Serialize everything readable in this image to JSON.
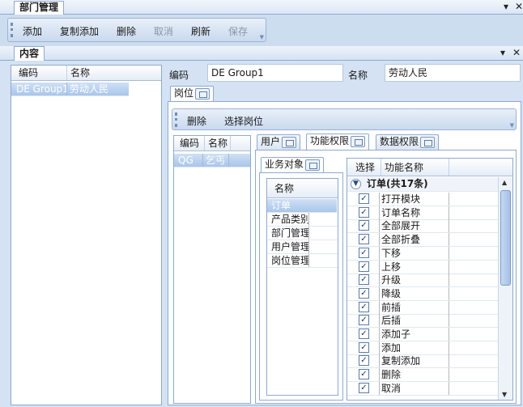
{
  "document": {
    "title": "部门管理",
    "controls": {
      "pin": "▾",
      "close": "✕"
    }
  },
  "toolbar": {
    "buttons": [
      {
        "label": "添加"
      },
      {
        "label": "复制添加"
      },
      {
        "label": "删除"
      },
      {
        "label": "取消"
      },
      {
        "label": "刷新"
      },
      {
        "label": "保存"
      }
    ]
  },
  "content_panel": {
    "title": "内容",
    "controls": {
      "pin": "▾",
      "close": "✕"
    }
  },
  "left_grid": {
    "headers": [
      "编码",
      "名称"
    ],
    "rows": [
      {
        "code": "DE Group1",
        "name": "劳动人民"
      }
    ]
  },
  "form": {
    "code_label": "编码",
    "code_value": "DE Group1",
    "name_label": "名称",
    "name_value": "劳动人民"
  },
  "position_tab": {
    "label": "岗位"
  },
  "position_toolbar": {
    "delete": "删除",
    "select": "选择岗位"
  },
  "position_grid": {
    "headers": [
      "编码",
      "名称"
    ],
    "rows": [
      {
        "code": "QG",
        "name": "乞丐"
      }
    ]
  },
  "right_tabs": [
    {
      "label": "用户"
    },
    {
      "label": "功能权限"
    },
    {
      "label": "数据权限"
    }
  ],
  "business_tab": {
    "label": "业务对象"
  },
  "business_grid": {
    "header": "名称",
    "rows": [
      "订单",
      "产品类别",
      "部门管理",
      "用户管理",
      "岗位管理"
    ]
  },
  "function_grid": {
    "headers": [
      "选择",
      "功能名称"
    ],
    "group_label": "订单(共17条)",
    "rows": [
      {
        "checked": "✓",
        "name": "打开模块"
      },
      {
        "checked": "✓",
        "name": "订单名称"
      },
      {
        "checked": "✓",
        "name": "全部展开"
      },
      {
        "checked": "✓",
        "name": "全部折叠"
      },
      {
        "checked": "✓",
        "name": "下移"
      },
      {
        "checked": "✓",
        "name": "上移"
      },
      {
        "checked": "✓",
        "name": "升级"
      },
      {
        "checked": "✓",
        "name": "降级"
      },
      {
        "checked": "✓",
        "name": "前插"
      },
      {
        "checked": "✓",
        "name": "后插"
      },
      {
        "checked": "✓",
        "name": "添加子"
      },
      {
        "checked": "✓",
        "name": "添加"
      },
      {
        "checked": "✓",
        "name": "复制添加"
      },
      {
        "checked": "✓",
        "name": "删除"
      },
      {
        "checked": "✓",
        "name": "取消"
      }
    ]
  },
  "colors": {
    "accent": "#8eaace",
    "selection": "#a9c6ea",
    "background": "#d4e2f3"
  }
}
